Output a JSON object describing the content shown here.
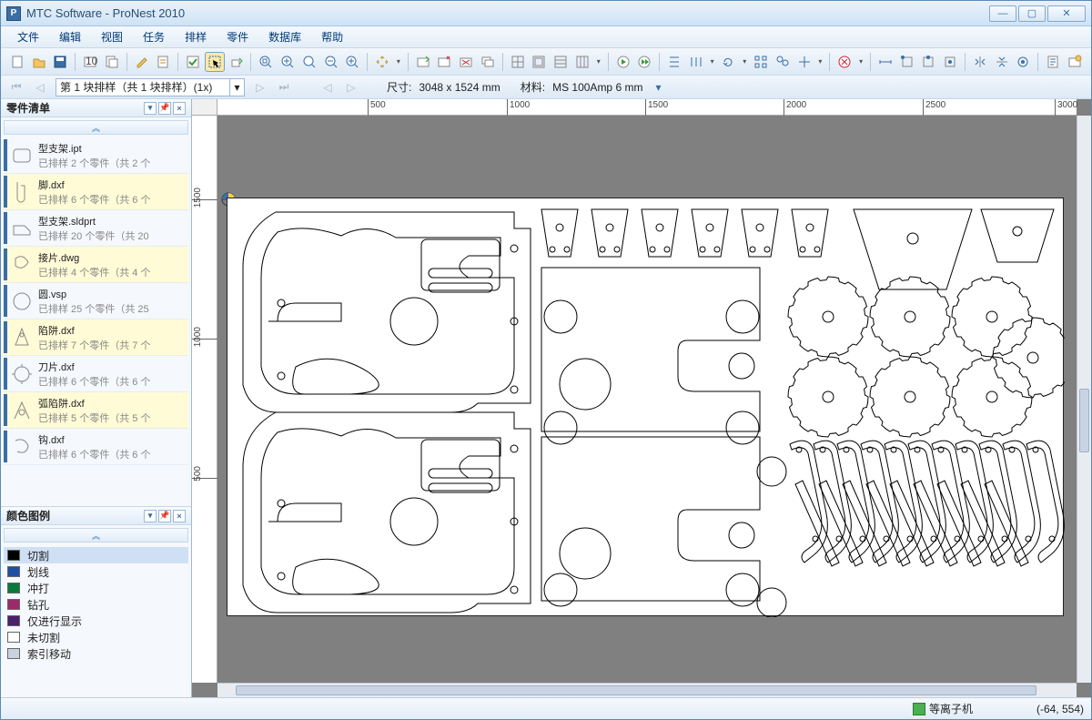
{
  "window": {
    "title": "MTC Software - ProNest 2010"
  },
  "menu": [
    "文件",
    "编辑",
    "视图",
    "任务",
    "排样",
    "零件",
    "数据库",
    "帮助"
  ],
  "nav": {
    "combo_value": "第 1 块排样（共 1 块排样）(1x)",
    "size_label": "尺寸:",
    "size_value": "3048 x 1524 mm",
    "material_label": "材料:",
    "material_value": "MS 100Amp 6 mm"
  },
  "sidebar": {
    "parts_title": "零件清单",
    "legend_title": "颜色图例",
    "parts": [
      {
        "name": "型支架.ipt",
        "sub": "已排样 2 个零件（共 2 个",
        "sel": false
      },
      {
        "name": "脚.dxf",
        "sub": "已排样 6 个零件（共 6 个",
        "sel": true
      },
      {
        "name": "型支架.sldprt",
        "sub": "已排样 20 个零件（共 20",
        "sel": false
      },
      {
        "name": "接片.dwg",
        "sub": "已排样 4 个零件（共 4 个",
        "sel": true
      },
      {
        "name": "圆.vsp",
        "sub": "已排样 25 个零件（共 25",
        "sel": false
      },
      {
        "name": "陷阱.dxf",
        "sub": "已排样 7 个零件（共 7 个",
        "sel": true
      },
      {
        "name": "刀片.dxf",
        "sub": "已排样 6 个零件（共 6 个",
        "sel": false
      },
      {
        "name": "弧陷阱.dxf",
        "sub": "已排样 5 个零件（共 5 个",
        "sel": true
      },
      {
        "name": "钩.dxf",
        "sub": "已排样 6 个零件（共 6 个",
        "sel": false
      }
    ],
    "legend": [
      {
        "label": "切割",
        "color": "#000000",
        "sel": true
      },
      {
        "label": "划线",
        "color": "#1e4fa3",
        "sel": false
      },
      {
        "label": "冲打",
        "color": "#0a7a3a",
        "sel": false
      },
      {
        "label": "钻孔",
        "color": "#9b2a6b",
        "sel": false
      },
      {
        "label": "仅进行显示",
        "color": "#4a1f6b",
        "sel": false
      },
      {
        "label": "未切割",
        "color": "#ffffff",
        "sel": false
      },
      {
        "label": "索引移动",
        "color": "#c9d2e0",
        "sel": false
      }
    ]
  },
  "ruler_h": [
    {
      "v": "500",
      "p": 165
    },
    {
      "v": "1000",
      "p": 318
    },
    {
      "v": "1500",
      "p": 470
    },
    {
      "v": "2000",
      "p": 622
    },
    {
      "v": "2500",
      "p": 775
    },
    {
      "v": "3000",
      "p": 920
    }
  ],
  "ruler_v": [
    {
      "v": "1500",
      "p": 92
    },
    {
      "v": "1000",
      "p": 245
    },
    {
      "v": "500",
      "p": 398
    }
  ],
  "status": {
    "mode": "等离子机",
    "coords": "(-64, 554)"
  }
}
